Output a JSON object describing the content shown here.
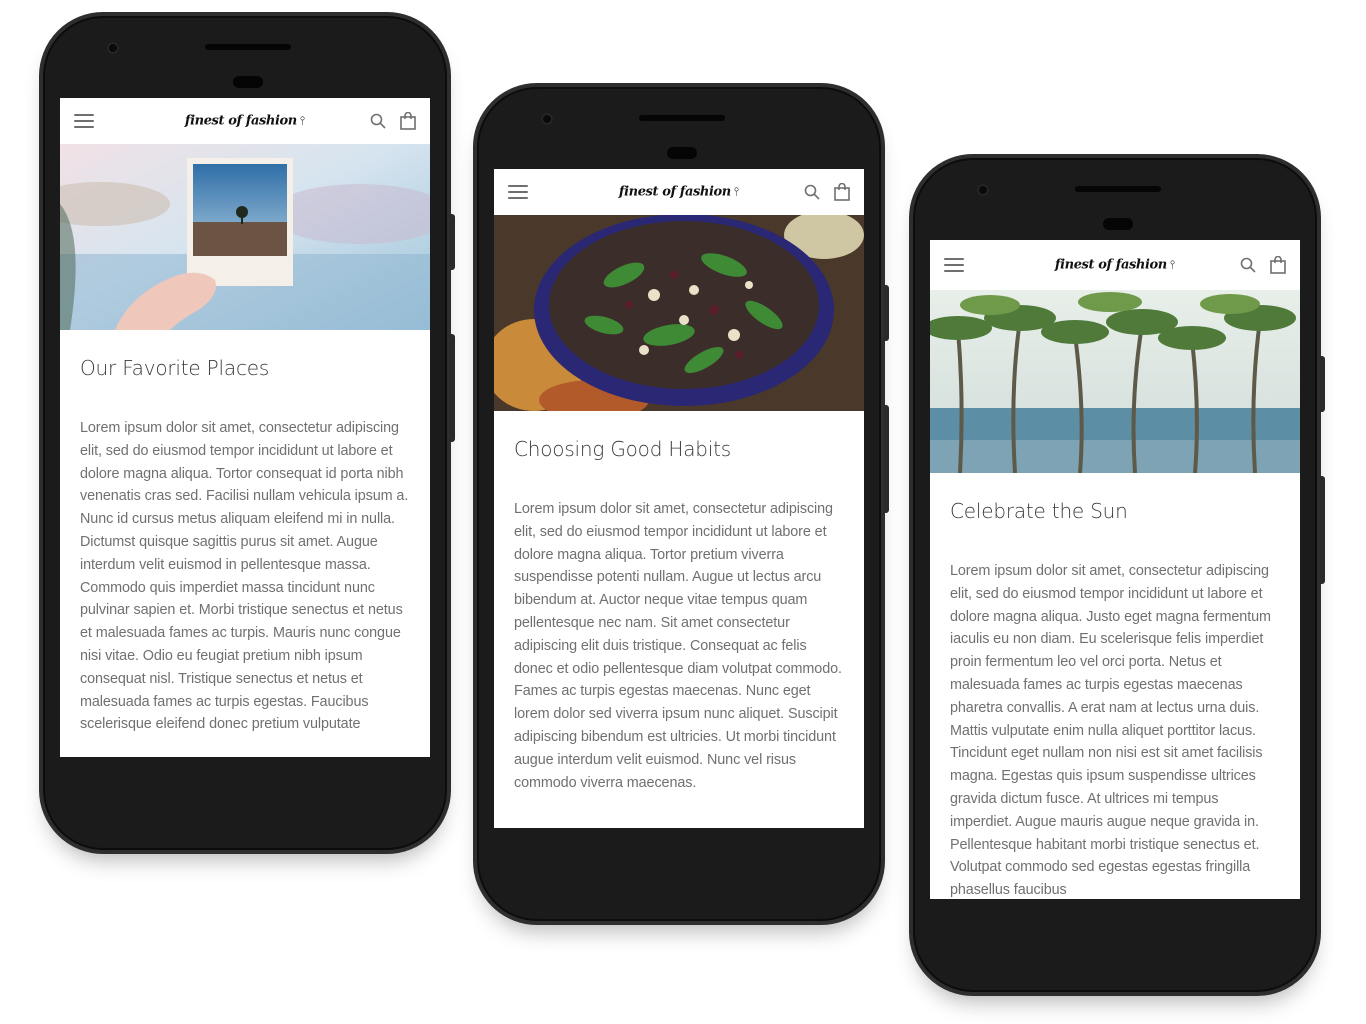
{
  "app": {
    "brand": "finest of fashion",
    "icons": {
      "menu": "hamburger-menu-icon",
      "search": "search-icon",
      "cart": "shopping-bag-icon",
      "brand_mark": "hanger-logo-icon"
    }
  },
  "colors": {
    "phone_body": "#1b1b1b",
    "screen_bg": "#ffffff",
    "title_text": "#3a3a3a",
    "body_text": "#707070",
    "icon_gray": "#6f6f6f"
  },
  "phones": [
    {
      "hero_alt": "Hand holding a polaroid photo of a tree in a field against a blurred seaside background",
      "title": "Our Favorite Places",
      "body": "Lorem ipsum dolor sit amet, consectetur adipiscing elit, sed do eiusmod tempor incididunt ut labore et dolore magna aliqua. Tortor consequat id porta nibh venenatis cras sed. Facilisi nullam vehicula ipsum a. Nunc id cursus metus aliquam eleifend mi in nulla. Dictumst quisque sagittis purus sit amet. Augue interdum velit euismod in pellentesque massa. Commodo quis imperdiet massa tincidunt nunc pulvinar sapien et. Morbi tristique senectus et netus et malesuada fames ac turpis. Mauris nunc congue nisi vitae. Odio eu feugiat pretium nibh ipsum consequat nisl. Tristique senectus et netus et malesuada fames ac turpis egestas. Faucibus scelerisque eleifend donec pretium vulputate"
    },
    {
      "hero_alt": "Salad bowl with greens and toppings on a wooden table",
      "title": "Choosing Good Habits",
      "body": "Lorem ipsum dolor sit amet, consectetur adipiscing elit, sed do eiusmod tempor incididunt ut labore et dolore magna aliqua. Tortor pretium viverra suspendisse potenti nullam. Augue ut lectus arcu bibendum at. Auctor neque vitae tempus quam pellentesque nec nam. Sit amet consectetur adipiscing elit duis tristique. Consequat ac felis donec et odio pellentesque diam volutpat commodo. Fames ac turpis egestas maecenas. Nunc eget lorem dolor sed viverra ipsum nunc aliquet. Suscipit adipiscing bibendum est ultricies. Ut morbi tincidunt augue interdum velit euismod. Nunc vel risus commodo viverra maecenas."
    },
    {
      "hero_alt": "Tall palm trees along a tropical beach",
      "title": "Celebrate the Sun",
      "body": "Lorem ipsum dolor sit amet, consectetur adipiscing elit, sed do eiusmod tempor incididunt ut labore et dolore magna aliqua. Justo eget magna fermentum iaculis eu non diam. Eu scelerisque felis imperdiet proin fermentum leo vel orci porta. Netus et malesuada fames ac turpis egestas maecenas pharetra convallis. A erat nam at lectus urna duis. Mattis vulputate enim nulla aliquet porttitor lacus. Tincidunt eget nullam non nisi est sit amet facilisis magna. Egestas quis ipsum suspendisse ultrices gravida dictum fusce. At ultrices mi tempus imperdiet. Augue mauris augue neque gravida in. Pellentesque habitant morbi tristique senectus et. Volutpat commodo sed egestas egestas fringilla phasellus faucibus"
    }
  ]
}
